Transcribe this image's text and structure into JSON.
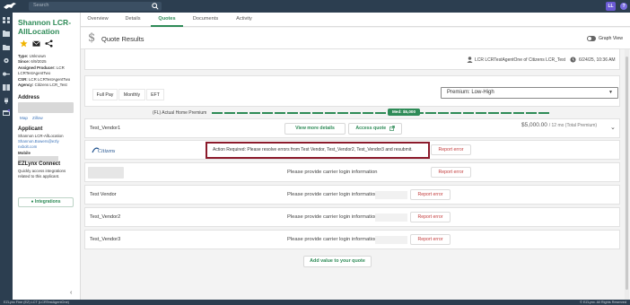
{
  "topbar": {
    "search_placeholder": "Search",
    "user_initials": "LL",
    "help_label": "?"
  },
  "contact": {
    "name": "Shannon LCR-AllLocation",
    "info_labels": [
      "Type:",
      "Since:",
      "Assigned Producer:",
      "CSR:",
      "Agency:"
    ],
    "info_values": [
      "Unknown",
      "6/9/2025",
      "LCR LCRTestAgentTwo",
      "LCR LCRTestAgentTwo",
      "Citizens LCR_Test"
    ],
    "address_heading": "Address",
    "map_link": "Map",
    "zillow_link": "Zillow",
    "applicant_heading": "Applicant",
    "applicant_name": "Shannon LCR-AllLocation",
    "applicant_email": "Shannon.Bowers@ezlynxbolt.com",
    "mobile_label": "Mobile",
    "connect_heading": "EZLynx Connect",
    "connect_desc": "Quickly access integrations related to this applicant.",
    "integrations_button": "Integrations"
  },
  "tabs": [
    "Overview",
    "Details",
    "Quotes",
    "Documents",
    "Activity"
  ],
  "active_tab": "Quotes",
  "page": {
    "title": "Quote Results",
    "graph_view_label": "Graph View",
    "agent": "LCR LCRTestAgentOne of Citizens LCR_Test",
    "date": "6/24/25, 10:36 AM"
  },
  "filters": {
    "segments": [
      "Full Pay",
      "Monthly",
      "EFT"
    ],
    "sort_value": "Premium: Low-High"
  },
  "premium_bar": {
    "label": "(FL) Actual Home Premium",
    "median_label": "Med: $5,000"
  },
  "quotes": [
    {
      "vendor": "Test_Vendor1",
      "view_more": "View more details",
      "access_quote": "Access quote",
      "price": "$5,000.00",
      "price_sub": "/ 12 mo (Total Premium)"
    },
    {
      "vendor_logo_text": "Citizens",
      "error_message": "Action Required: Please resolve errors from Test Vendor, Test_Vendor2, Test_Vendor3 and resubmit.",
      "report_button": "Report error"
    },
    {
      "login_message": "Please provide carrier login information",
      "report_button": "Report error"
    },
    {
      "vendor": "Test Vendor",
      "login_message": "Please provide carrier login information",
      "report_button": "Report error"
    },
    {
      "vendor": "Test_Vendor2",
      "login_message": "Please provide carrier login information",
      "report_button": "Report error"
    },
    {
      "vendor": "Test_Vendor3",
      "login_message": "Please provide carrier login information",
      "report_button": "Report error"
    }
  ],
  "add_value_button": "Add value to your quote",
  "footer": {
    "left": "EZLynx Fine (EZ) LCT (LCRTestAgentOne)",
    "right": "© EZLynx. All Rights Reserved"
  },
  "colors": {
    "brand_green": "#2e8b57",
    "nav_dark": "#2c3e50",
    "error_border": "#8b1a2b",
    "report_red": "#c23b3b"
  }
}
